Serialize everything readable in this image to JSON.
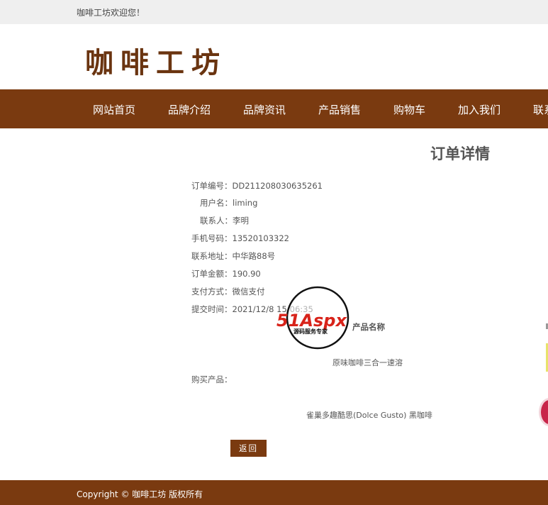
{
  "topbar": {
    "welcome": "咖啡工坊欢迎您！"
  },
  "logo": {
    "text": "咖啡工坊"
  },
  "nav": {
    "items": [
      "网站首页",
      "品牌介绍",
      "品牌资讯",
      "产品销售",
      "购物车",
      "加入我们",
      "联系"
    ]
  },
  "page": {
    "title": "订单详情"
  },
  "order": {
    "fields": [
      {
        "label": "订单编号：",
        "value": "DD211208030635261"
      },
      {
        "label": "用户名：",
        "value": "liming"
      },
      {
        "label": "联系人：",
        "value": "李明"
      },
      {
        "label": "手机号码：",
        "value": "13520103322"
      },
      {
        "label": "联系地址：",
        "value": "中华路88号"
      },
      {
        "label": "订单金额：",
        "value": "190.90"
      },
      {
        "label": "支付方式：",
        "value": "微信支付"
      },
      {
        "label": "提交时间：",
        "value": "2021/12/8 15:06:35"
      }
    ],
    "products_label": "购买产品：",
    "product_column_header": "产品名称",
    "products": [
      "原味咖啡三合一速溶",
      "雀巢多趣酷思(Dolce Gusto) 黑咖啡"
    ],
    "back_label": "返回"
  },
  "watermark": {
    "brand": "51Aspx",
    "tagline": "源码服务专家"
  },
  "footer": {
    "copyright": "Copyright © 咖啡工坊 版权所有"
  },
  "colors": {
    "brand_brown": "#7a3a10",
    "topbar_bg": "#efefef"
  }
}
